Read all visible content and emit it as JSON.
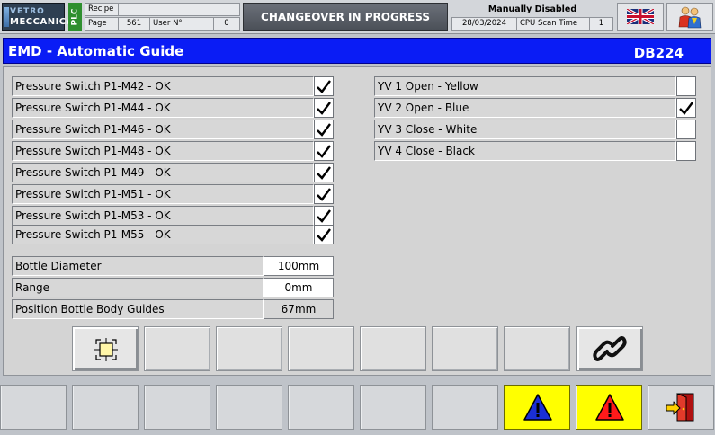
{
  "header": {
    "logo_line1": "VETRO",
    "logo_line2": "MECCANICA",
    "plc_label": "PLC",
    "recipe_label": "Recipe",
    "recipe_value": "",
    "page_label": "Page",
    "page_value": "561",
    "user_label": "User N°",
    "user_value": "0",
    "banner": "CHANGEOVER IN PROGRESS",
    "manual_status": "Manually Disabled",
    "date": "28/03/2024",
    "cpu_label": "CPU Scan Time",
    "cpu_value": "1",
    "language_icon": "uk-flag-icon",
    "users_icon": "users-icon"
  },
  "title": {
    "text": "EMD - Automatic Guide",
    "db": "DB224"
  },
  "pressure_switches": [
    {
      "label": "Pressure Switch P1-M42 - OK",
      "checked": true
    },
    {
      "label": "Pressure Switch P1-M44 - OK",
      "checked": true
    },
    {
      "label": "Pressure Switch  P1-M46 - OK",
      "checked": true
    },
    {
      "label": "Pressure Switch  P1-M48 - OK",
      "checked": true
    },
    {
      "label": "Pressure Switch  P1-M49 - OK",
      "checked": true
    },
    {
      "label": "Pressure Switch  P1-M51 - OK",
      "checked": true
    },
    {
      "label": "Pressure Switch  P1-M53 - OK",
      "checked": true
    },
    {
      "label": "Pressure Switch  P1-M55 - OK",
      "checked": true
    }
  ],
  "valves": [
    {
      "label": "YV 1 Open - Yellow",
      "checked": false
    },
    {
      "label": "YV 2 Open - Blue",
      "checked": true
    },
    {
      "label": "YV 3 Close - White",
      "checked": false
    },
    {
      "label": "YV 4 Close - Black",
      "checked": false
    }
  ],
  "parameters": {
    "bottle_diameter_label": "Bottle Diameter",
    "bottle_diameter_value": "100mm",
    "range_label": "Range",
    "range_value": "0mm",
    "position_label": "Position Bottle Body Guides",
    "position_value": "67mm"
  },
  "function_keys": {
    "first_icon": "target-frame-icon",
    "last_icon": "chain-link-icon"
  },
  "footer": {
    "warning_blue_icon": "warning-blue-icon",
    "warning_red_icon": "warning-red-icon",
    "exit_icon": "exit-door-icon"
  },
  "colors": {
    "title_bar": "#0a1cf5",
    "plc": "#2f8f2f",
    "alarm_yellow": "#ffff00",
    "alarm_red": "#ff1a1a",
    "alarm_blue": "#1a2fd6"
  }
}
